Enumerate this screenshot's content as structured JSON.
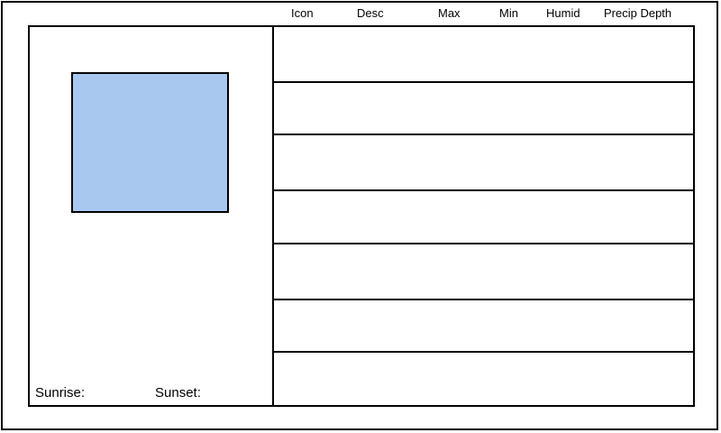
{
  "headers": {
    "icon": "Icon",
    "desc": "Desc",
    "max": "Max",
    "min": "Min",
    "humid": "Humid",
    "precip_depth": "Precip Depth"
  },
  "left_panel": {
    "icon_fill": "#a8c8f0",
    "sunrise_label": "Sunrise:",
    "sunset_label": "Sunset:"
  },
  "forecast_rows": [
    {},
    {},
    {},
    {},
    {},
    {},
    {}
  ]
}
